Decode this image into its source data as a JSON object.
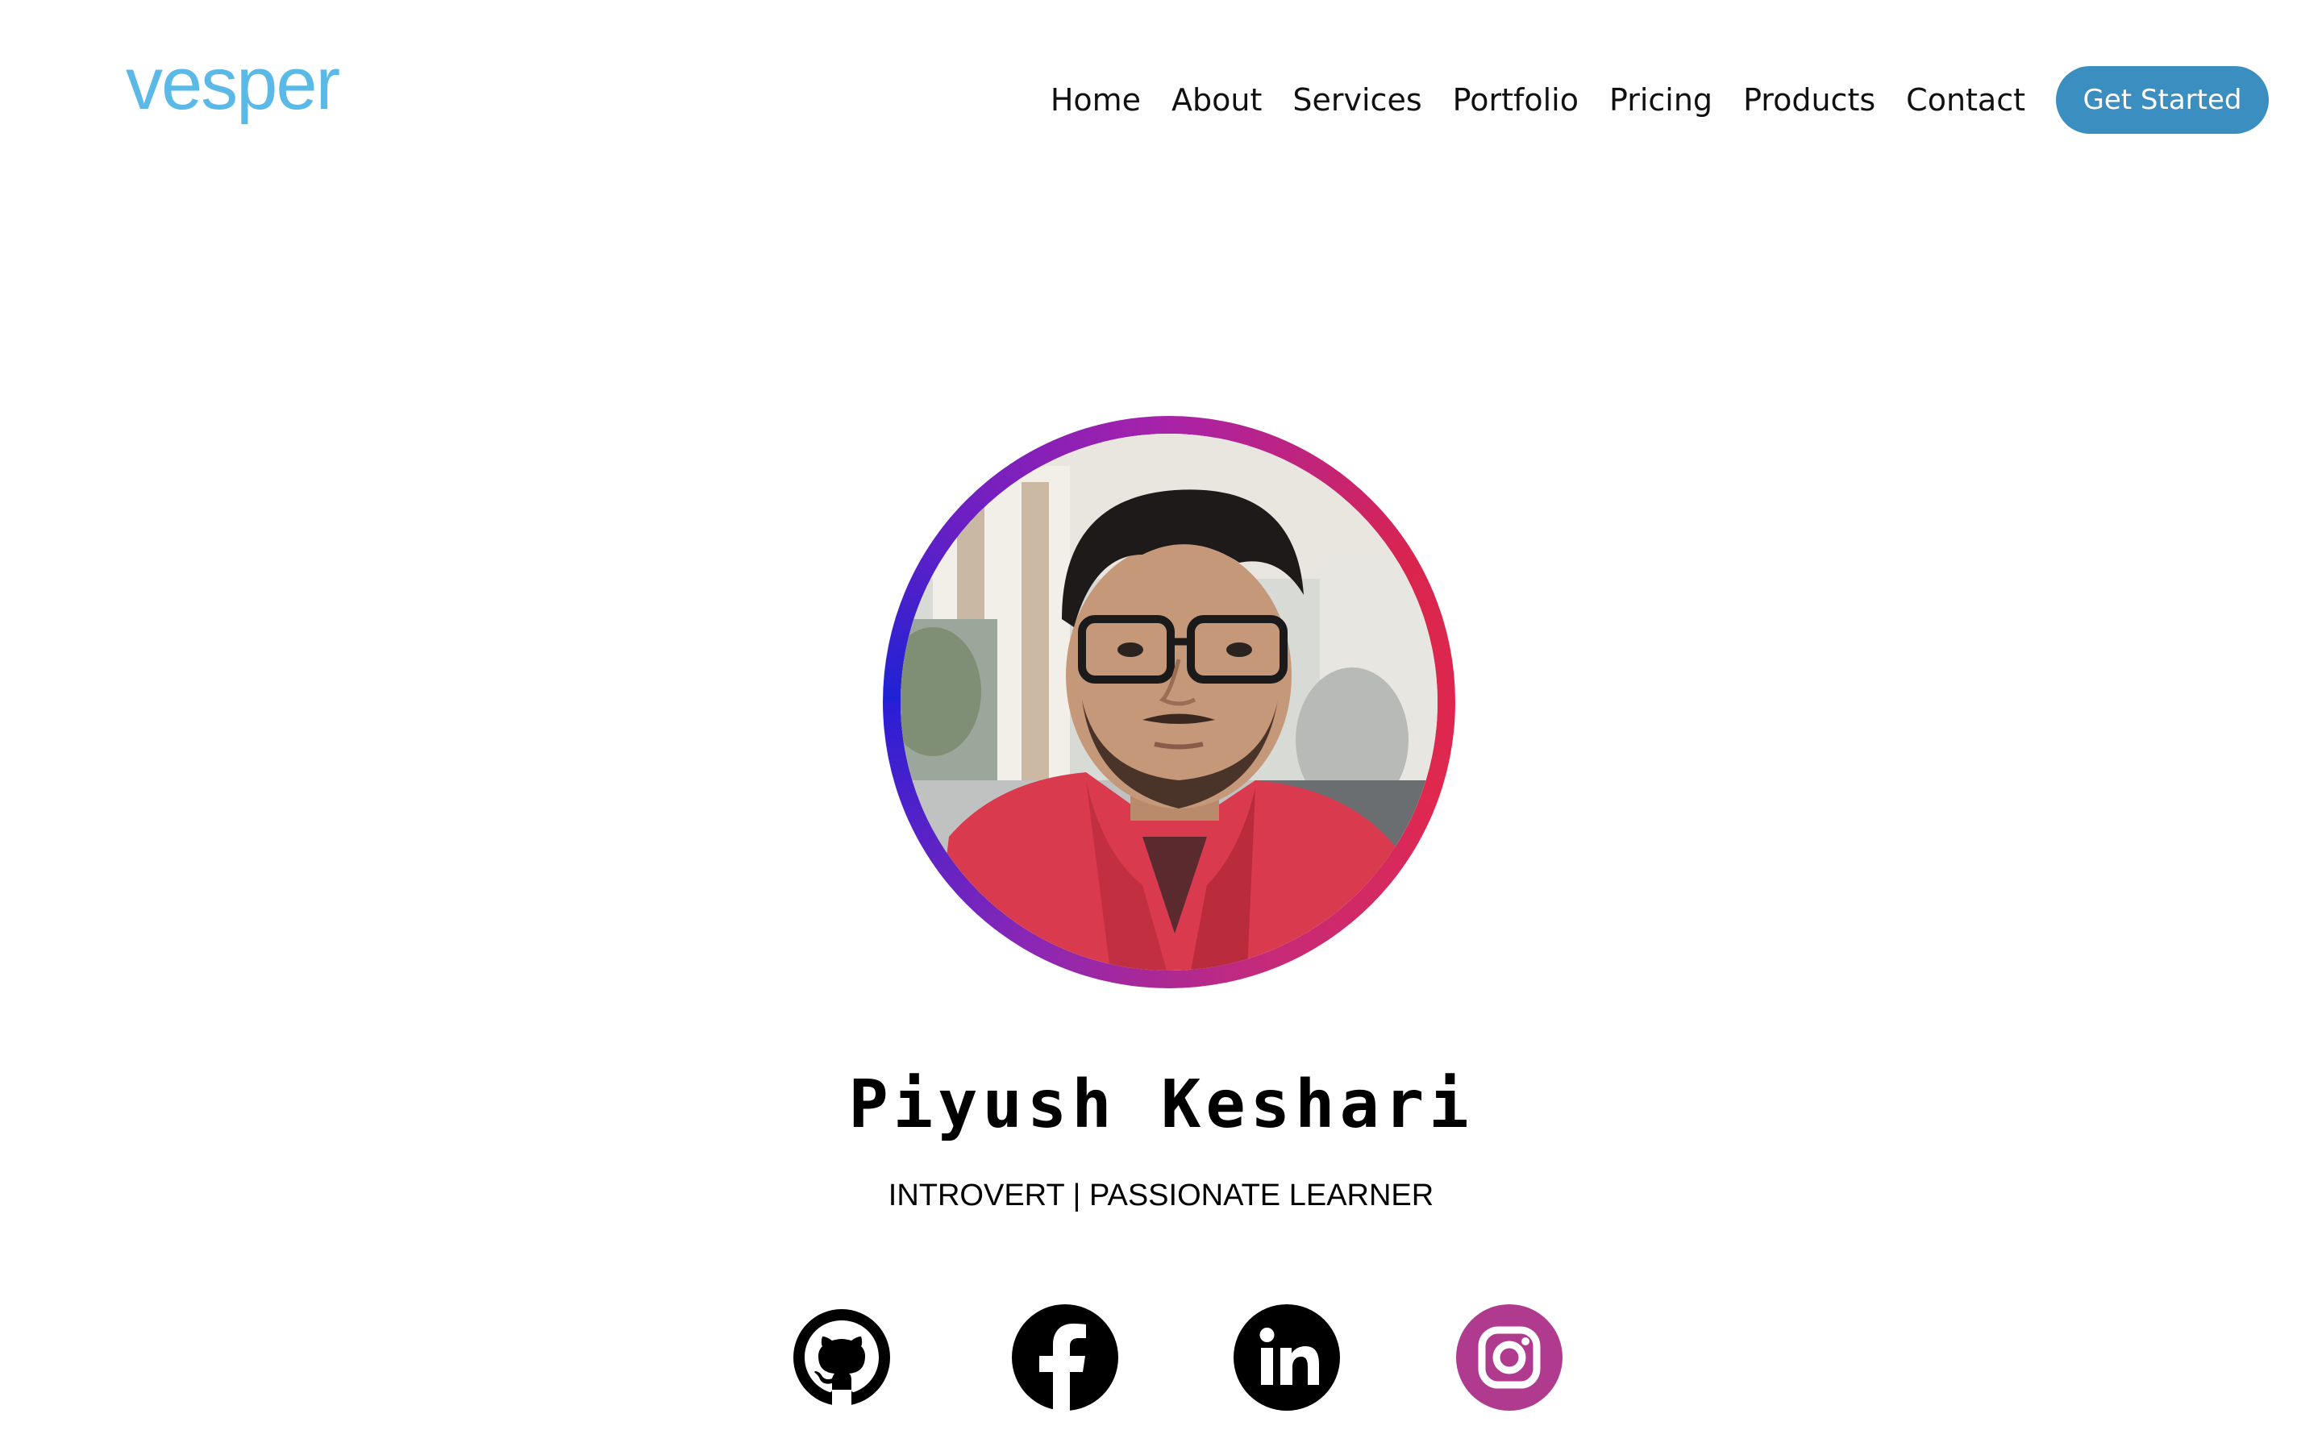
{
  "header": {
    "logo_text": "vesper",
    "nav": [
      {
        "label": "Home"
      },
      {
        "label": "About"
      },
      {
        "label": "Services"
      },
      {
        "label": "Portfolio"
      },
      {
        "label": "Pricing"
      },
      {
        "label": "Products"
      },
      {
        "label": "Contact"
      }
    ],
    "cta_label": "Get Started"
  },
  "profile": {
    "name": "Piyush Keshari",
    "tagline": "INTROVERT | PASSIONATE LEARNER"
  },
  "socials": [
    {
      "icon": "github-icon",
      "color": "#000000"
    },
    {
      "icon": "facebook-icon",
      "color": "#000000"
    },
    {
      "icon": "linkedin-icon",
      "color": "#000000"
    },
    {
      "icon": "instagram-icon",
      "color": "#b03a8e"
    }
  ],
  "colors": {
    "logo": "#5ab9e6",
    "cta_background": "#3a8fc0",
    "avatar_ring_gradient": [
      "#1d22d4",
      "#a922a8",
      "#e0284f"
    ]
  }
}
